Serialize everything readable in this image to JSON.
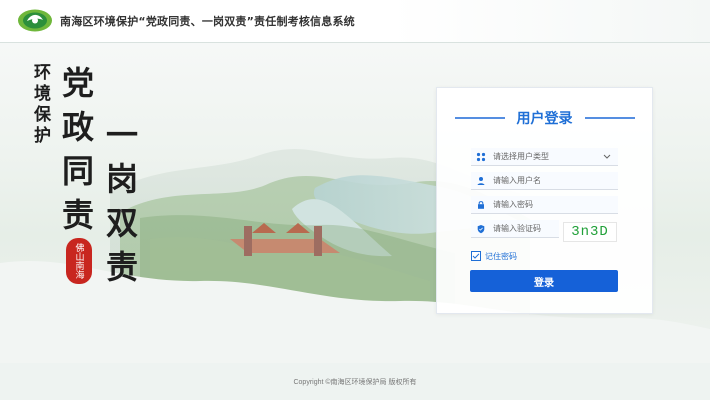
{
  "header": {
    "title": "南海区环境保护“党政同责、一岗双责”责任制考核信息系统",
    "logo_icon": "environment-logo-icon"
  },
  "hero": {
    "slogan_small": "环境保护",
    "slogan_col1": "党政同责",
    "slogan_col2": "一岗双责",
    "seal_text": "佛山南海"
  },
  "login": {
    "title": "用户登录",
    "user_type_placeholder": "请选择用户类型",
    "username_placeholder": "请输入用户名",
    "password_placeholder": "请输入密码",
    "captcha_placeholder": "请输入验证码",
    "captcha_text": "3n3D",
    "remember_label": "记住密码",
    "submit_label": "登录"
  },
  "footer": {
    "copyright": "Copyright ©南海区环境保护局  版权所有"
  },
  "colors": {
    "accent": "#1f6fd6",
    "button": "#1561d8",
    "captcha": "#20a038",
    "seal": "#c8261f"
  }
}
